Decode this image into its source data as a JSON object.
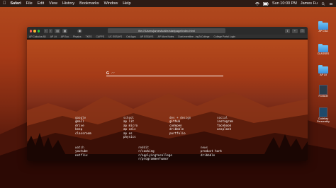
{
  "menubar": {
    "app": "Safari",
    "items": [
      "File",
      "Edit",
      "View",
      "History",
      "Bookmarks",
      "Window",
      "Help"
    ],
    "clock": "Sun 10:00 PM",
    "user": "James Fu"
  },
  "desktop_icons": [
    {
      "label": "AP CSA",
      "kind": "folder"
    },
    {
      "label": "CLASSES",
      "kind": "folder"
    },
    {
      "label": "AP Lit",
      "kind": "folder"
    },
    {
      "label": "Fonts.ttf",
      "kind": "doc"
    },
    {
      "label": "Codebay Personality",
      "kind": "doc"
    }
  ],
  "browser": {
    "url": "file:///Users/jamesfu/site/startpage/index.html",
    "favorites": [
      "AP Calculus AB",
      "AP Lit",
      "AP Eco",
      "Physics",
      "TKES",
      "CAPPS",
      "UC ESSAYS",
      "Cal Apps",
      "AP ESSAYS",
      "AP More Notes",
      "Duel.eventline...IngToCollege",
      "College Portal Login"
    ]
  },
  "search": {
    "placeholder": "/?"
  },
  "groups": {
    "google": {
      "title": "google",
      "links": [
        "gmail",
        "drive",
        "keep",
        "classroom"
      ]
    },
    "school": {
      "title": "school",
      "links": [
        "ap lit",
        "ap micro",
        "ap calc",
        "ap es",
        "physics"
      ]
    },
    "dev": {
      "title": "dev + design",
      "links": [
        "github",
        "codepen",
        "dribbble",
        "portfolio"
      ]
    },
    "social": {
      "title": "social",
      "links": [
        "instagram",
        "facebook",
        "unsplash"
      ]
    },
    "watch": {
      "title": "watch",
      "links": [
        "youtube",
        "netflix"
      ]
    },
    "reddit": {
      "title": "reddit",
      "links": [
        "r/cooking",
        "r/applyingtocollege",
        "r/programmerhumor"
      ]
    },
    "news": {
      "title": "news",
      "links": [
        "product hunt",
        "dribbble"
      ]
    }
  },
  "colors": {
    "wallpaper_top": "#b54b1d",
    "wallpaper_bottom": "#2e0b06",
    "window_chrome": "#2b2b2b"
  }
}
